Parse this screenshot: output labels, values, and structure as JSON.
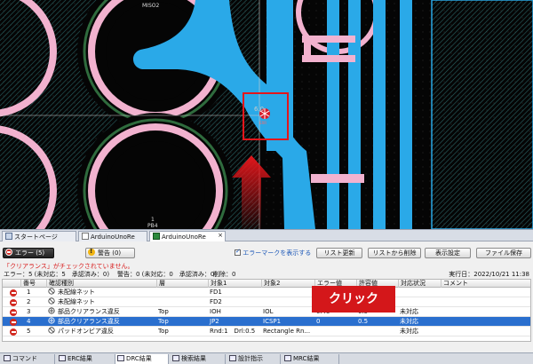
{
  "canvas": {
    "labels": {
      "top_pin": "MISO2",
      "pin_number": "1",
      "pin_name": "PB4",
      "marker_value": "6.0",
      "marker_tag": "ERR"
    },
    "colors": {
      "background": "#050505",
      "trace": "#2aa9e8",
      "silk": "#f2b2cf"
    }
  },
  "document_tabs": [
    {
      "label": "スタートページ"
    },
    {
      "label": "ArduinoUnoRe"
    },
    {
      "label": "ArduinoUnoRe",
      "close": "×"
    }
  ],
  "drc": {
    "error_button": "エラー (5)",
    "warning_button": "警告 (0)",
    "show_markers_checkbox": "エラーマークを表示する",
    "show_markers_checked": true,
    "buttons": {
      "update_list": "リスト更新",
      "delete_from_list": "リストから削除",
      "display_settings": "表示設定",
      "save_file": "ファイル保存"
    },
    "message": "「クリアランス」がチェックされていません。",
    "summary": {
      "errors": "エラー：5 (未対応：5　承認済み：0)",
      "warnings": "警告：0 (未対応：0　承認済み：0)",
      "deleted": "削除：0",
      "run_date": "実行日：2022/10/21 11:38"
    },
    "columns": [
      "番号",
      "確認種別",
      "層",
      "対象1",
      "対象2",
      "エラー値",
      "許容値",
      "対応状況",
      "コメント"
    ],
    "rows": [
      {
        "num": "1",
        "type": "未配線ネット",
        "type_icon": "no-entry-icon",
        "layer": "",
        "target1": "FD1",
        "target2": "",
        "error_value": "",
        "tolerance": "",
        "status": "",
        "comment": ""
      },
      {
        "num": "2",
        "type": "未配線ネット",
        "type_icon": "no-entry-icon",
        "layer": "",
        "target1": "FD2",
        "target2": "",
        "error_value": "",
        "tolerance": "",
        "status": "",
        "comment": ""
      },
      {
        "num": "3",
        "type": "部品クリアランス違反",
        "type_icon": "clearance-icon",
        "layer": "Top",
        "target1": "IOH",
        "target2": "IOL",
        "error_value": "0.45",
        "tolerance": "0.5",
        "status": "未対応",
        "comment": ""
      },
      {
        "num": "4",
        "type": "部品クリアランス違反",
        "type_icon": "clearance-icon",
        "layer": "Top",
        "target1": "JP2",
        "target2": "ICSP1",
        "error_value": "0",
        "tolerance": "0.5",
        "status": "未対応",
        "comment": "",
        "selected": true
      },
      {
        "num": "5",
        "type": "パッドオンビア違反",
        "type_icon": "no-entry-icon",
        "layer": "Top",
        "target1": "Rnd:1　Drl:0.5",
        "target2": "Rectangle Rn...",
        "error_value": "",
        "tolerance": "",
        "status": "未対応",
        "comment": ""
      }
    ]
  },
  "bottom_tabs": [
    {
      "label": "コマンド"
    },
    {
      "label": "ERC結果"
    },
    {
      "label": "DRC結果",
      "active": true
    },
    {
      "label": "検索結果"
    },
    {
      "label": "設計指示"
    },
    {
      "label": "MRC結果"
    }
  ],
  "callout": {
    "label": "クリック",
    "color": "#d4171a"
  }
}
